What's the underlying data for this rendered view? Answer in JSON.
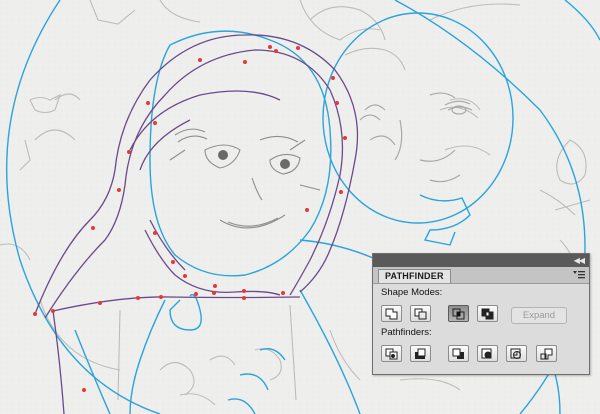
{
  "panel": {
    "title": "PATHFINDER",
    "shape_modes_label": "Shape Modes:",
    "pathfinders_label": "Pathfinders:",
    "expand_label": "Expand",
    "shape_modes": [
      {
        "icon": "unite-icon",
        "active": false
      },
      {
        "icon": "minus-front-icon",
        "active": false
      },
      {
        "icon": "intersect-icon",
        "active": true
      },
      {
        "icon": "exclude-icon",
        "active": false
      }
    ],
    "pathfinders": [
      {
        "icon": "divide-icon"
      },
      {
        "icon": "trim-icon"
      },
      {
        "icon": "merge-icon"
      },
      {
        "icon": "crop-icon"
      },
      {
        "icon": "outline-icon"
      },
      {
        "icon": "minus-back-icon"
      }
    ]
  },
  "colors": {
    "guide_blue": "#2aa4dc",
    "path_purple": "#6a4a8c",
    "anchor_red": "#e4393b",
    "sketch_gray": "#b9b9b9"
  }
}
